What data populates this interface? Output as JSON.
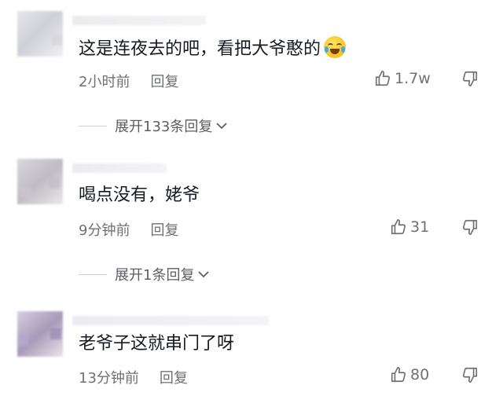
{
  "comments": [
    {
      "text": "这是连夜去的吧，看把大爷憨的",
      "emoji": "rolling-laughing-emoji",
      "time": "2小时前",
      "reply_label": "回复",
      "likes": "1.7w",
      "expand_label": "展开133条回复"
    },
    {
      "text": "喝点没有，姥爷",
      "time": "9分钟前",
      "reply_label": "回复",
      "likes": "31",
      "expand_label": "展开1条回复"
    },
    {
      "text": "老爷子这就串门了呀",
      "time": "13分钟前",
      "reply_label": "回复",
      "likes": "80"
    }
  ],
  "icons": {
    "like": "thumbs-up-icon",
    "dislike": "thumbs-down-icon",
    "expand": "chevron-down-icon"
  },
  "colors": {
    "text": "#161823",
    "meta": "#6f7075"
  }
}
